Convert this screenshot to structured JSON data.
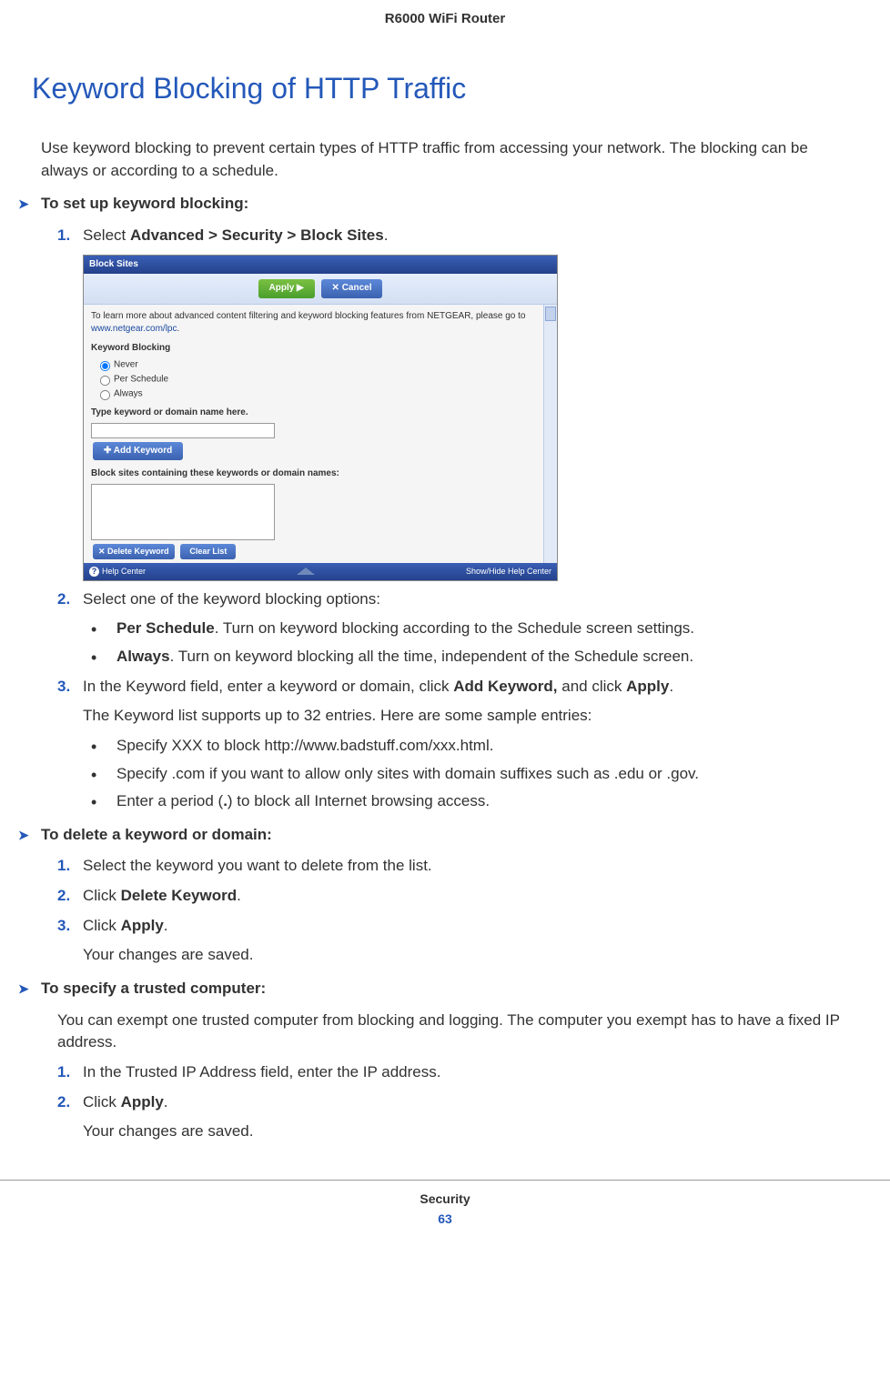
{
  "header": {
    "product": "R6000 WiFi Router"
  },
  "title": "Keyword Blocking of HTTP Traffic",
  "intro": "Use keyword blocking to prevent certain types of HTTP traffic from accessing your network. The blocking can be always or according to a schedule.",
  "proc1": {
    "heading": "To set up keyword blocking:",
    "step1_pre": "Select ",
    "step1_bold": "Advanced > Security > Block Sites",
    "step1_post": ".",
    "step2": "Select one of the keyword blocking options:",
    "opt_per_label": "Per Schedule",
    "opt_per_text": ". Turn on keyword blocking according to the Schedule screen settings.",
    "opt_always_label": "Always",
    "opt_always_text": ". Turn on keyword blocking all the time, independent of the Schedule screen.",
    "step3_a": "In the Keyword field, enter a keyword or domain, click ",
    "step3_b1": "Add Keyword,",
    "step3_c": " and click ",
    "step3_b2": "Apply",
    "step3_d": ".",
    "step3_sub": "The Keyword list supports up to 32 entries. Here are some sample entries:",
    "sample1": "Specify XXX to block http://www.badstuff.com/xxx.html.",
    "sample2": "Specify .com if you want to allow only sites with domain suffixes such as .edu or .gov.",
    "sample3_a": "Enter a period (",
    "sample3_b": ".",
    "sample3_c": ") to block all Internet browsing access."
  },
  "proc2": {
    "heading": "To delete a keyword or domain:",
    "step1": "Select the keyword you want to delete from the list.",
    "step2_a": "Click ",
    "step2_b": "Delete Keyword",
    "step2_c": ".",
    "step3_a": "Click ",
    "step3_b": "Apply",
    "step3_c": ".",
    "step3_sub": "Your changes are saved."
  },
  "proc3": {
    "heading": "To specify a trusted computer:",
    "intro": "You can exempt one trusted computer from blocking and logging. The computer you exempt has to have a fixed IP address.",
    "step1": "In the Trusted IP Address field, enter the IP address.",
    "step2_a": "Click ",
    "step2_b": "Apply",
    "step2_c": ".",
    "step2_sub": "Your changes are saved."
  },
  "screenshot": {
    "window_title": "Block Sites",
    "apply_btn": "Apply ▶",
    "cancel_btn": "✕ Cancel",
    "info_text_a": "To learn more about advanced content filtering and keyword blocking features from NETGEAR, please go to ",
    "info_link": "www.netgear.com/lpc",
    "info_text_b": ".",
    "kb_label": "Keyword Blocking",
    "radio_never": "Never",
    "radio_per": "Per Schedule",
    "radio_always": "Always",
    "type_label": "Type keyword or domain name here.",
    "add_btn": "✚ Add Keyword",
    "list_label": "Block sites containing these keywords or domain names:",
    "delete_btn": "✕ Delete Keyword",
    "clear_btn": "Clear List",
    "help_center": "Help Center",
    "show_hide": "Show/Hide Help Center"
  },
  "footer": {
    "section": "Security",
    "page": "63"
  },
  "nums": {
    "n1": "1.",
    "n2": "2.",
    "n3": "3."
  },
  "bullet": "•",
  "chevron": "➤"
}
